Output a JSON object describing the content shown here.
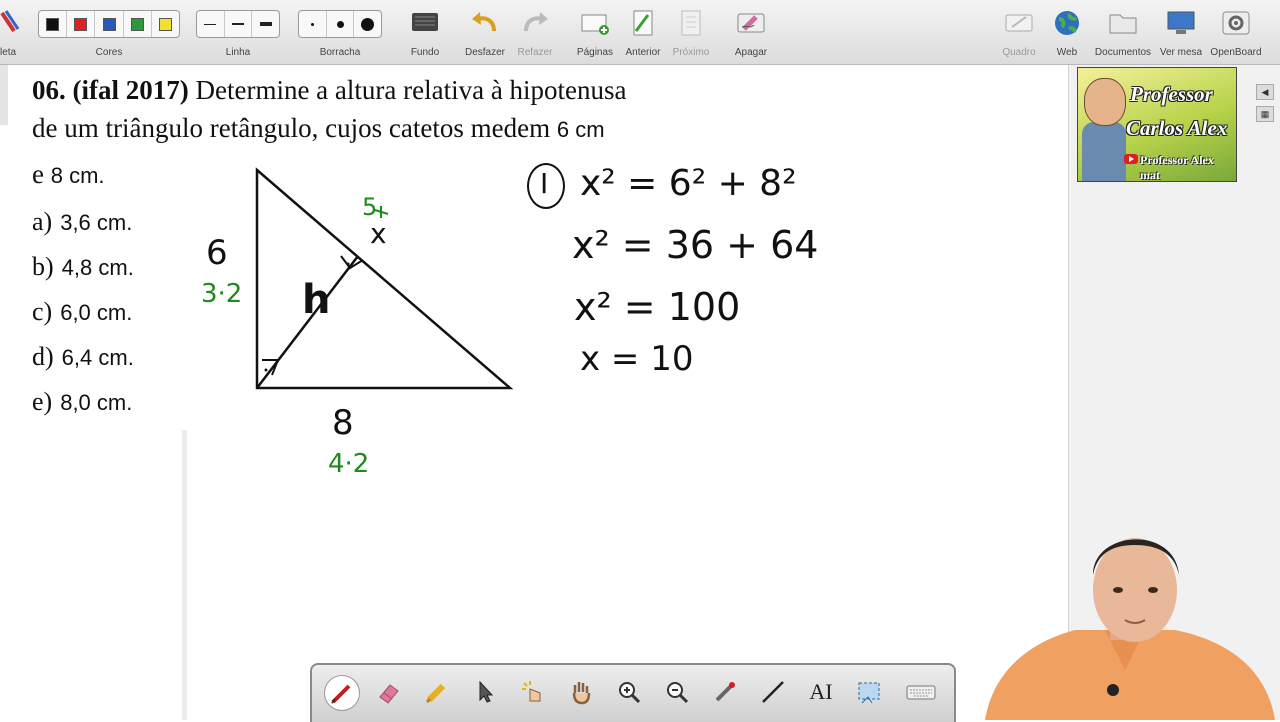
{
  "toolbar": {
    "left_partial_label": "leta",
    "colors_label": "Cores",
    "line_label": "Linha",
    "eraser_label": "Borracha",
    "background_label": "Fundo",
    "undo_label": "Desfazer",
    "redo_label": "Refazer",
    "pages_label": "Páginas",
    "previous_label": "Anterior",
    "next_label": "Próximo",
    "erase_label": "Apagar",
    "board_label": "Quadro",
    "web_label": "Web",
    "documents_label": "Documentos",
    "desktop_label": "Ver mesa",
    "openboard_label": "OpenBoard",
    "pen_colors": [
      "#111111",
      "#e02020",
      "#2a57b8",
      "#2a9a3a",
      "#f2e030"
    ]
  },
  "question": {
    "number": "06.",
    "source": "(ifal 2017)",
    "line1": "Determine a altura relativa à hipotenusa",
    "line2": "de um triângulo retângulo, cujos catetos medem",
    "leg1": "6 cm",
    "line3_prefix": "e",
    "leg2": "8 cm."
  },
  "options": [
    {
      "letter": "a)",
      "value": "3,6 cm."
    },
    {
      "letter": "b)",
      "value": "4,8 cm."
    },
    {
      "letter": "c)",
      "value": "6,0 cm."
    },
    {
      "letter": "d)",
      "value": "6,4 cm."
    },
    {
      "letter": "e)",
      "value": "8,0 cm."
    }
  ],
  "handwriting": {
    "side_left": "6",
    "side_left_green": "3·2",
    "side_bottom": "8",
    "side_bottom_green": "4·2",
    "hyp_green": "5",
    "hyp_x": "x",
    "height_label": "h",
    "step_marker": "I",
    "eq1": "x² = 6² + 8²",
    "eq2": "x² = 36 + 64",
    "eq3": "x² = 100",
    "eq4": "x = 10"
  },
  "logo": {
    "line1": "Professor",
    "line2": "Carlos Alex",
    "channel": "Professor Alex mat"
  },
  "dock": {
    "tools": [
      "pen-icon",
      "eraser-icon",
      "highlighter-icon",
      "pointer-icon",
      "interact-icon",
      "hand-icon",
      "zoom-in-icon",
      "zoom-out-icon",
      "laser-icon",
      "line-icon",
      "text-icon",
      "capture-icon",
      "keyboard-icon"
    ],
    "text_tool_glyph": "AI"
  },
  "colors": {
    "ink": "#111111",
    "green_ink": "#1e8a1e",
    "toolbar_bg": "#e4e4e4"
  }
}
